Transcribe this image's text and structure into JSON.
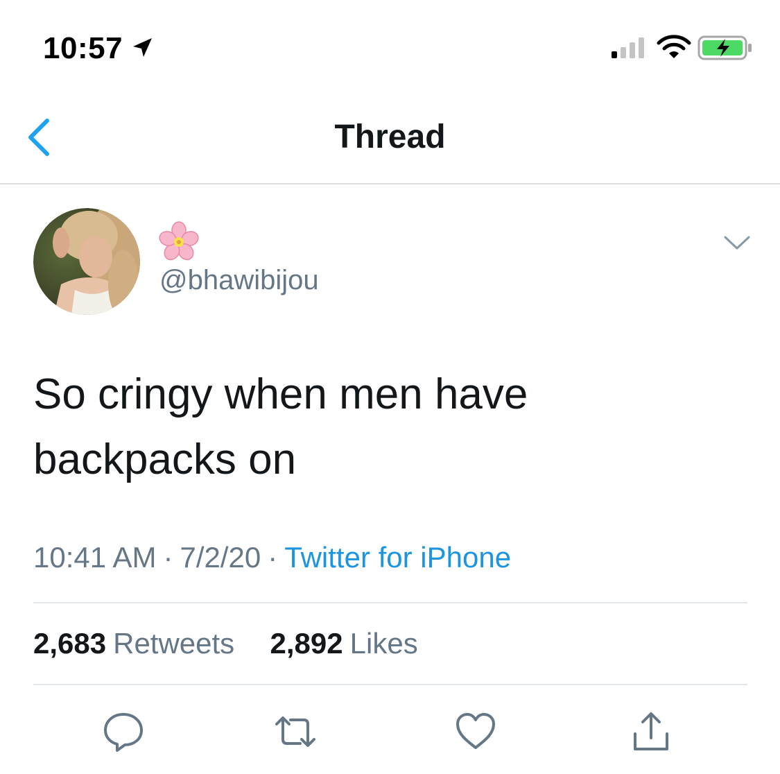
{
  "status_bar": {
    "time": "10:57",
    "icons": [
      "location-arrow-icon",
      "cellular-signal-icon",
      "wifi-icon",
      "battery-charging-icon"
    ],
    "battery_color": "#4cd964"
  },
  "nav": {
    "title": "Thread",
    "back_icon": "chevron-left-icon",
    "accent_color": "#1da1f2"
  },
  "tweet": {
    "display_name_emoji": "cherry-blossom-icon",
    "handle": "@bhawibijou",
    "text": "So cringy when men have backpacks on",
    "time": "10:41 AM",
    "separator": "·",
    "date": "7/2/20",
    "source": "Twitter for iPhone",
    "retweets_count": "2,683",
    "retweets_label": "Retweets",
    "likes_count": "2,892",
    "likes_label": "Likes"
  },
  "actions": [
    "reply-icon",
    "retweet-icon",
    "heart-icon",
    "share-icon"
  ]
}
